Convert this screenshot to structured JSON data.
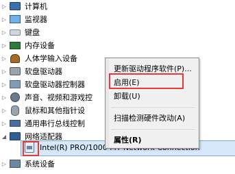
{
  "tree": {
    "items": [
      {
        "label": "计算机",
        "icon": "computer-icon"
      },
      {
        "label": "监视器",
        "icon": "monitor-icon"
      },
      {
        "label": "键盘",
        "icon": "keyboard-icon"
      },
      {
        "label": "内存设备",
        "icon": "memory-icon"
      },
      {
        "label": "人体学输入设备",
        "icon": "hid-icon"
      },
      {
        "label": "软盘驱动器",
        "icon": "floppy-drive-icon"
      },
      {
        "label": "软盘驱动器控制器",
        "icon": "controller-icon"
      },
      {
        "label": "声音、视频和游戏控",
        "icon": "sound-icon"
      },
      {
        "label": "鼠标和其他指针设",
        "icon": "mouse-icon"
      },
      {
        "label": "通用串行总线控制",
        "icon": "usb-icon"
      },
      {
        "label": "网络适配器",
        "icon": "network-icon"
      },
      {
        "label": "Intel(R) PRO/1000 MT Network Connection",
        "icon": "network-card-icon"
      },
      {
        "label": "系统设备",
        "icon": "system-icon"
      }
    ]
  },
  "context_menu": {
    "items": [
      {
        "label": "更新驱动程序软件(P)..."
      },
      {
        "label": "启用(E)"
      },
      {
        "label": "卸载(U)"
      },
      {
        "label": "扫描检测硬件改动(A)"
      },
      {
        "label": "属性(R)"
      }
    ]
  },
  "colors": {
    "highlight_border": "#e53935",
    "selection_fill": "#d7e8fb"
  }
}
